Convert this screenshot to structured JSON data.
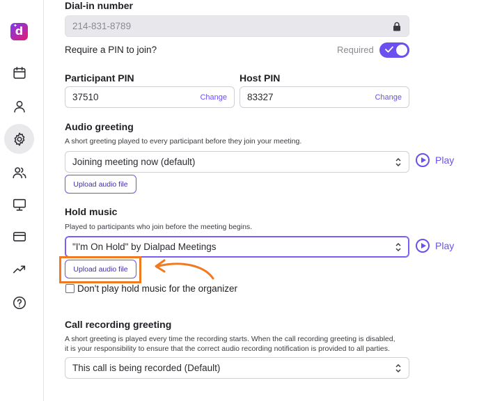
{
  "sidebar": {
    "logo_letter": "d",
    "items": [
      {
        "name": "calendar-icon",
        "active": false
      },
      {
        "name": "person-icon",
        "active": false
      },
      {
        "name": "gear-icon",
        "active": true
      },
      {
        "name": "people-icon",
        "active": false
      },
      {
        "name": "monitor-icon",
        "active": false
      },
      {
        "name": "card-icon",
        "active": false
      },
      {
        "name": "trending-icon",
        "active": false
      },
      {
        "name": "help-icon",
        "active": false
      }
    ]
  },
  "dial_in": {
    "label": "Dial-in number",
    "value": "214-831-8789"
  },
  "pin_required": {
    "label": "Require a PIN to join?",
    "status": "Required",
    "enabled": true
  },
  "participant_pin": {
    "label": "Participant PIN",
    "value": "37510",
    "change_label": "Change"
  },
  "host_pin": {
    "label": "Host PIN",
    "value": "83327",
    "change_label": "Change"
  },
  "audio_greeting": {
    "label": "Audio greeting",
    "help": "A short greeting played to every participant before they join your meeting.",
    "selected": "Joining meeting now (default)",
    "play_label": "Play",
    "upload_label": "Upload audio file"
  },
  "hold_music": {
    "label": "Hold music",
    "help": "Played to participants who join before the meeting begins.",
    "selected": "\"I'm On Hold\" by Dialpad Meetings",
    "play_label": "Play",
    "upload_label": "Upload audio file",
    "checkbox_label": "Don't play hold music for the organizer",
    "checkbox_checked": false
  },
  "call_recording": {
    "label": "Call recording greeting",
    "help_line1": "A short greeting is played every time the recording starts. When the call recording greeting is disabled,",
    "help_line2": "it is your responsibility to ensure that the correct audio recording notification is provided to all parties.",
    "selected": "This call is being recorded (Default)"
  },
  "colors": {
    "accent": "#6b4ff0",
    "annotation": "#f07a22"
  }
}
